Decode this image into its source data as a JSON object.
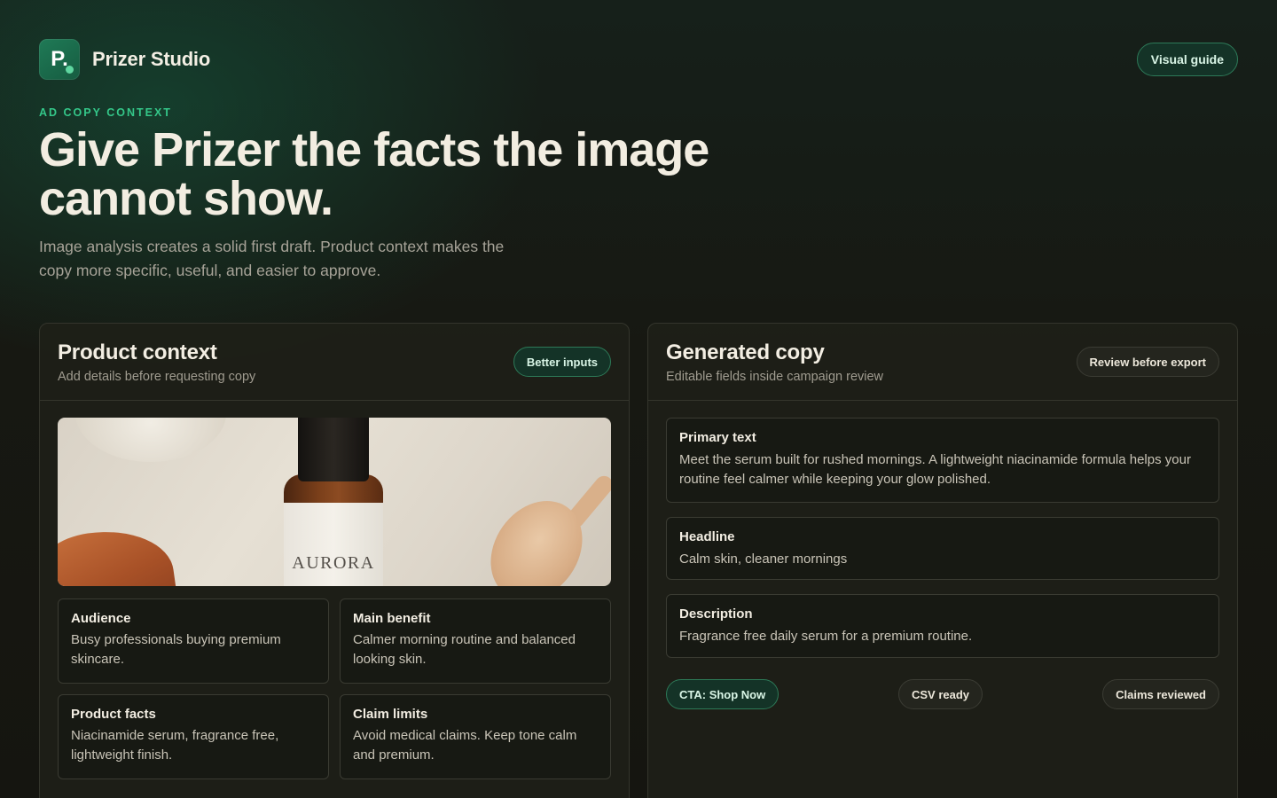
{
  "app": {
    "name": "Prizer Studio",
    "logo_letter": "P.",
    "visual_guide_label": "Visual guide"
  },
  "hero": {
    "eyebrow": "AD COPY CONTEXT",
    "title": "Give Prizer the facts the image cannot show.",
    "subtitle": "Image analysis creates a solid first draft. Product context makes the copy more specific, useful, and easier to approve."
  },
  "product_context": {
    "title": "Product context",
    "subtitle": "Add details before requesting copy",
    "badge": "Better inputs",
    "image_brand_text": "AURORA",
    "fields": [
      {
        "label": "Audience",
        "value": "Busy professionals buying premium skincare."
      },
      {
        "label": "Main benefit",
        "value": "Calmer morning routine and balanced looking skin."
      },
      {
        "label": "Product facts",
        "value": "Niacinamide serum, fragrance free, lightweight finish."
      },
      {
        "label": "Claim limits",
        "value": "Avoid medical claims. Keep tone calm and premium."
      }
    ]
  },
  "generated_copy": {
    "title": "Generated copy",
    "subtitle": "Editable fields inside campaign review",
    "badge": "Review before export",
    "primary_text": {
      "label": "Primary text",
      "value": "Meet the serum built for rushed mornings. A lightweight niacinamide formula helps your routine feel calmer while keeping your glow polished."
    },
    "headline": {
      "label": "Headline",
      "value": "Calm skin, cleaner mornings"
    },
    "description": {
      "label": "Description",
      "value": "Fragrance free daily serum for a premium routine."
    },
    "tags": {
      "cta": "CTA: Shop Now",
      "csv": "CSV ready",
      "claims": "Claims reviewed"
    }
  }
}
